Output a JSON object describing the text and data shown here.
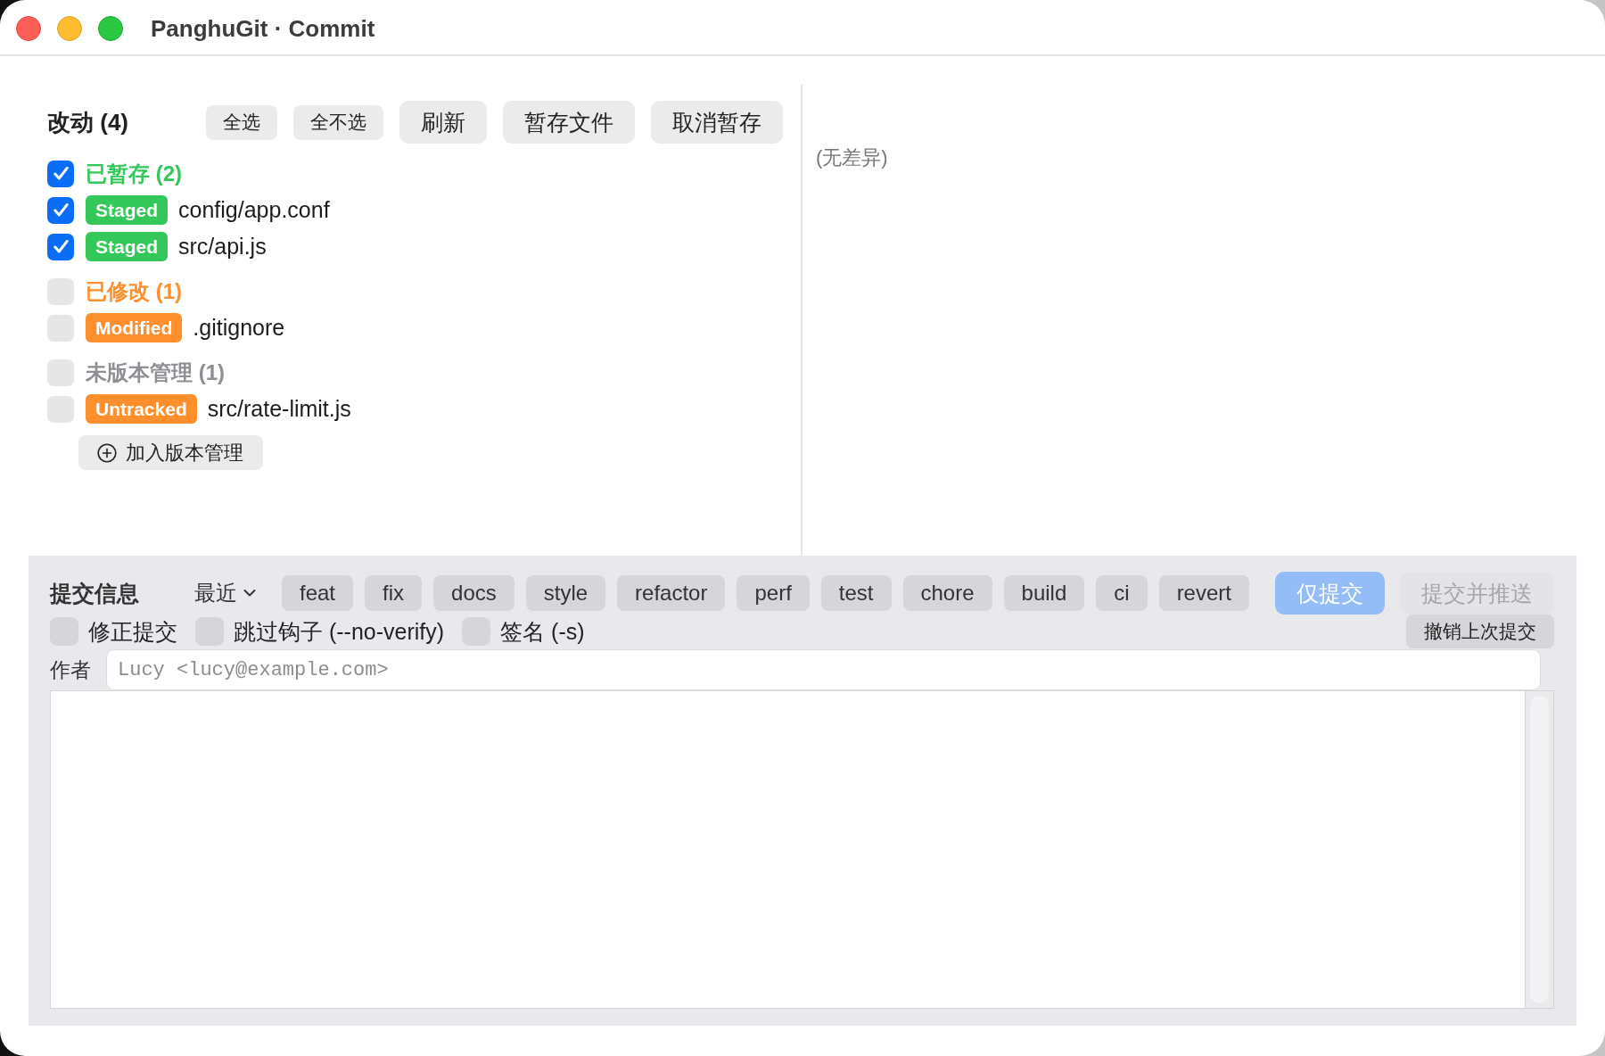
{
  "window": {
    "title": "PanghuGit · Commit"
  },
  "changes": {
    "title": "改动 (4)",
    "toolbar": [
      {
        "label": "全选",
        "kind": "compact"
      },
      {
        "label": "全不选",
        "kind": "compact"
      },
      {
        "label": "刷新",
        "kind": "regular"
      },
      {
        "label": "暂存文件",
        "kind": "regular"
      },
      {
        "label": "取消暂存",
        "kind": "regular"
      }
    ],
    "groups": [
      {
        "title": "已暂存 (2)",
        "color": "#34c759",
        "checked": true,
        "files": [
          {
            "badge": "Staged",
            "color": "#34c759",
            "path": "config/app.conf",
            "checked": true
          },
          {
            "badge": "Staged",
            "color": "#34c759",
            "path": "src/api.js",
            "checked": true
          }
        ]
      },
      {
        "title": "已修改 (1)",
        "color": "#ff8f2c",
        "checked": false,
        "files": [
          {
            "badge": "Modified",
            "color": "#ff8f2c",
            "path": ".gitignore",
            "checked": false
          }
        ]
      },
      {
        "title": "未版本管理 (1)",
        "color": "#8e8e93",
        "checked": false,
        "files": [
          {
            "badge": "Untracked",
            "color": "#ff8f2c",
            "path": "src/rate-limit.js",
            "checked": false
          }
        ],
        "action": "加入版本管理"
      }
    ]
  },
  "diff": {
    "empty_text": "(无差异)"
  },
  "commit": {
    "title": "提交信息",
    "recent": "最近",
    "types": [
      "feat",
      "fix",
      "docs",
      "style",
      "refactor",
      "perf",
      "test",
      "chore",
      "build",
      "ci",
      "revert"
    ],
    "actions": [
      {
        "label": "仅提交",
        "kind": "primary",
        "disabled": true
      },
      {
        "label": "提交并推送",
        "kind": "secondary",
        "disabled": true
      }
    ],
    "options": [
      {
        "label": "修正提交",
        "checked": false
      },
      {
        "label": "跳过钩子 (--no-verify)",
        "checked": false
      },
      {
        "label": "签名 (-s)",
        "checked": false
      }
    ],
    "undo_button": "撤销上次提交",
    "author": {
      "label": "作者",
      "placeholder": "Lucy <lucy@example.com>"
    }
  }
}
